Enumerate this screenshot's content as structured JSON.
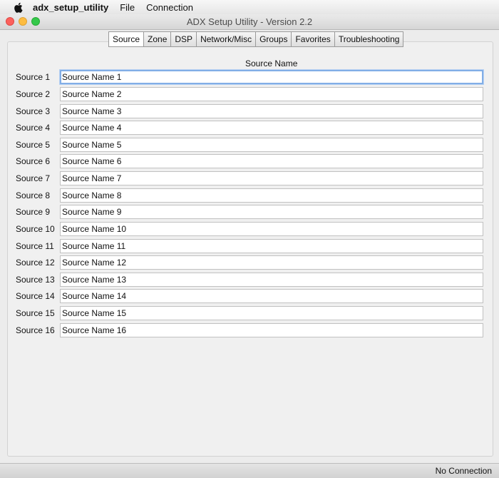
{
  "menubar": {
    "app_name": "adx_setup_utility",
    "items": [
      "File",
      "Connection"
    ]
  },
  "window": {
    "title": "ADX Setup Utility - Version 2.2"
  },
  "tabs": [
    {
      "label": "Source",
      "active": true
    },
    {
      "label": "Zone"
    },
    {
      "label": "DSP"
    },
    {
      "label": "Network/Misc"
    },
    {
      "label": "Groups"
    },
    {
      "label": "Favorites"
    },
    {
      "label": "Troubleshooting"
    }
  ],
  "source_tab": {
    "column_header": "Source Name",
    "rows": [
      {
        "label": "Source 1",
        "value": "Source Name 1"
      },
      {
        "label": "Source 2",
        "value": "Source Name 2"
      },
      {
        "label": "Source 3",
        "value": "Source Name 3"
      },
      {
        "label": "Source 4",
        "value": "Source Name 4"
      },
      {
        "label": "Source 5",
        "value": "Source Name 5"
      },
      {
        "label": "Source 6",
        "value": "Source Name 6"
      },
      {
        "label": "Source 7",
        "value": "Source Name 7"
      },
      {
        "label": "Source 8",
        "value": "Source Name 8"
      },
      {
        "label": "Source 9",
        "value": "Source Name 9"
      },
      {
        "label": "Source 10",
        "value": "Source Name 10"
      },
      {
        "label": "Source 11",
        "value": "Source Name 11"
      },
      {
        "label": "Source 12",
        "value": "Source Name 12"
      },
      {
        "label": "Source 13",
        "value": "Source Name 13"
      },
      {
        "label": "Source 14",
        "value": "Source Name 14"
      },
      {
        "label": "Source 15",
        "value": "Source Name 15"
      },
      {
        "label": "Source 16",
        "value": "Source Name 16"
      }
    ]
  },
  "status": {
    "connection": "No Connection"
  },
  "colors": {
    "focus_ring": "#82aee6",
    "close": "#fc605c",
    "minimize": "#fdbc40",
    "maximize": "#34c84a"
  }
}
